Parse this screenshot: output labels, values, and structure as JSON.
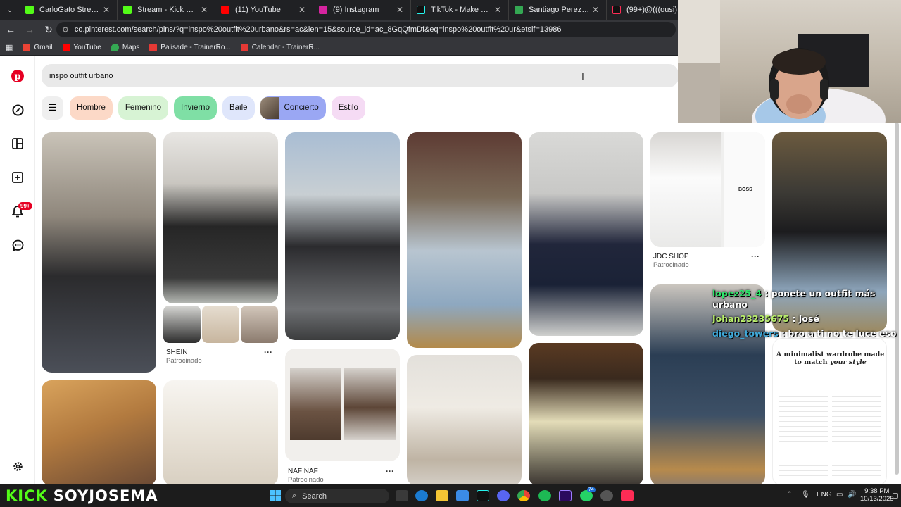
{
  "browser": {
    "tabs": [
      {
        "title": "CarloGato Stream - Watch",
        "color": "#53fc18"
      },
      {
        "title": "Stream - Kick Dashboard",
        "color": "#53fc18"
      },
      {
        "title": "(11) YouTube",
        "color": "#ff0000"
      },
      {
        "title": "(9) Instagram",
        "color": "#d6249f"
      },
      {
        "title": "TikTok - Make Your Day",
        "color": "#111111"
      },
      {
        "title": "Santiago Perez, Bogotá",
        "color": "#34a853"
      },
      {
        "title": "(99+)@(((ousi))) #ousi",
        "color": "#111111"
      }
    ],
    "url": "co.pinterest.com/search/pins/?q=inspo%20outfit%20urbano&rs=ac&len=15&source_id=ac_8GqQfmDf&eq=inspo%20outfit%20ur&etslf=13986",
    "bookmarks": [
      {
        "label": "Gmail",
        "color": "#ea4335"
      },
      {
        "label": "YouTube",
        "color": "#ff0000"
      },
      {
        "label": "Maps",
        "color": "#34a853"
      },
      {
        "label": "Palisade - TrainerRo...",
        "color": "#e53935"
      },
      {
        "label": "Calendar - TrainerR...",
        "color": "#e53935"
      }
    ]
  },
  "pinterest": {
    "search_query": "inspo outfit urbano",
    "notifications_badge": "99+",
    "chips": [
      {
        "label": "Hombre",
        "bg": "#fcd9c7"
      },
      {
        "label": "Femenino",
        "bg": "#d7f3d4"
      },
      {
        "label": "Invierno",
        "bg": "#7fdfa5"
      },
      {
        "label": "Baile",
        "bg": "#dfe6fb"
      },
      {
        "label": "Concierto",
        "bg": "#9aa7f3"
      },
      {
        "label": "Estilo",
        "bg": "#f5dbf4"
      }
    ],
    "sponsored": [
      {
        "name": "SHEIN",
        "sub": "Patrocinado"
      },
      {
        "name": "JDC SHOP",
        "sub": "Patrocinado"
      },
      {
        "name": "NAF NAF",
        "sub": "Patrocinado"
      }
    ],
    "pin_text": {
      "title": "A minimalist wardrobe made to match",
      "title_em": "your style",
      "boss": "BOSS"
    }
  },
  "chat": [
    {
      "user": "lopez25_4",
      "msg": ": ponete un outfit más urbano"
    },
    {
      "user": "Johan23235675",
      "msg": ": José"
    },
    {
      "user": "diego_towers",
      "msg": ": bro a ti no te luce eso"
    }
  ],
  "stream": {
    "kick": "KICK",
    "channel": "SOYJOSEMA"
  },
  "taskbar": {
    "search": "Search",
    "lang": "ENG",
    "time": "9:38 PM",
    "date": "10/13/2025",
    "badge_count": "74"
  }
}
